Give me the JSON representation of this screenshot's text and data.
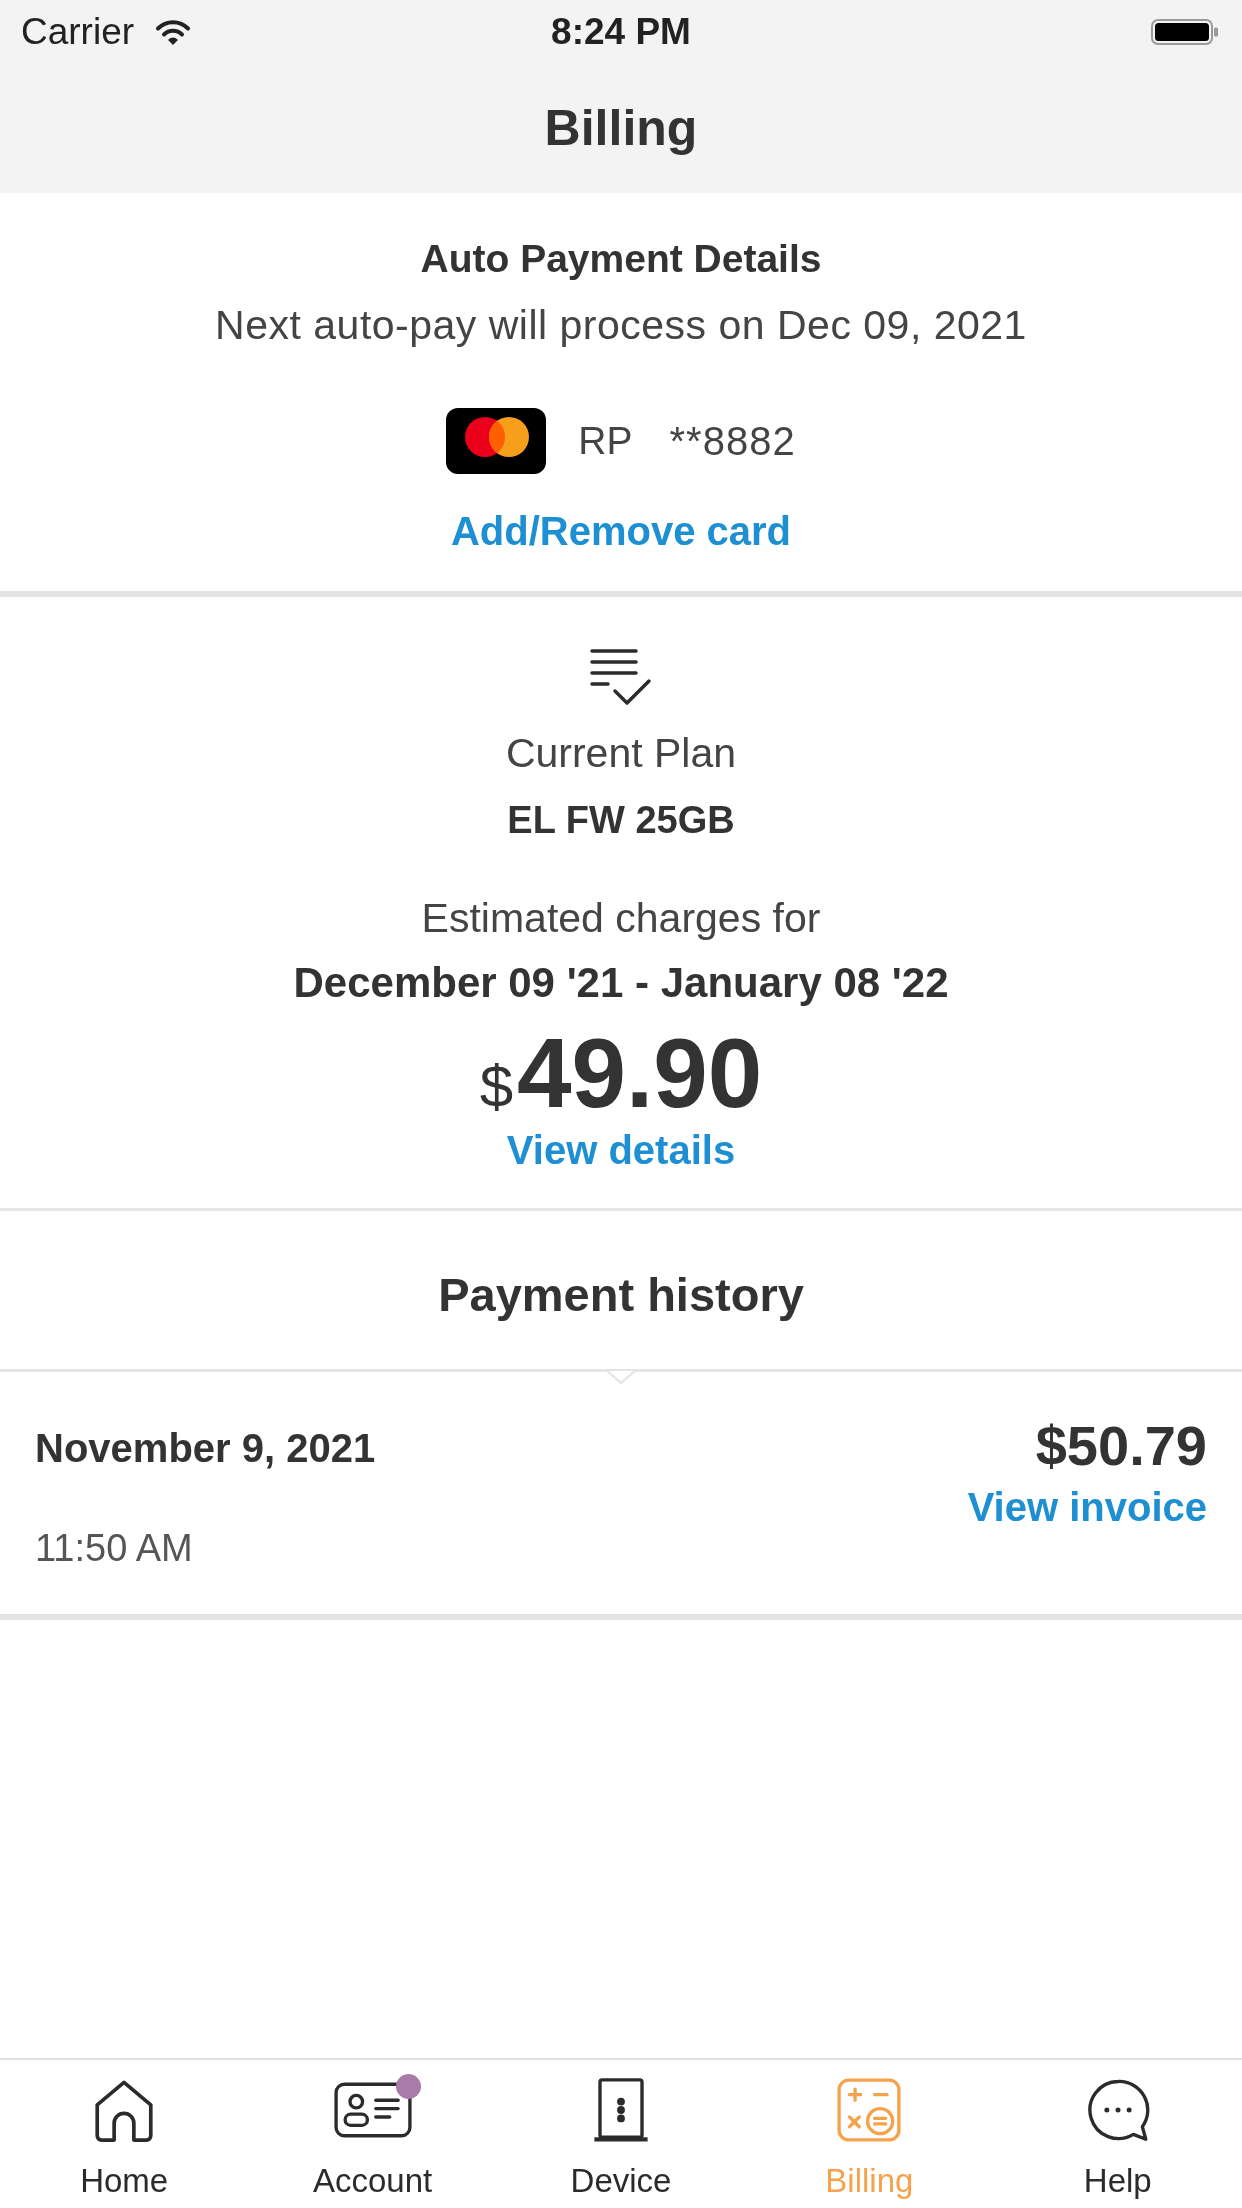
{
  "status_bar": {
    "carrier": "Carrier",
    "time": "8:24 PM"
  },
  "nav_bar": {
    "title": "Billing"
  },
  "auto_payment": {
    "title": "Auto Payment Details",
    "subtitle": "Next auto-pay will process on Dec 09, 2021",
    "card": {
      "holder": "RP",
      "number": "**8882"
    },
    "link": "Add/Remove card"
  },
  "plan": {
    "label": "Current Plan",
    "name": "EL FW 25GB",
    "charges_label": "Estimated charges for",
    "period": "December 09 '21 - January 08 '22",
    "currency": "$",
    "amount": "49.90",
    "link": "View details"
  },
  "payment_history": {
    "title": "Payment history",
    "items": [
      {
        "date": "November 9, 2021",
        "time": "11:50 AM",
        "amount": "$50.79",
        "link": "View invoice"
      }
    ]
  },
  "tab_bar": [
    {
      "label": "Home",
      "selected": false,
      "badge": false
    },
    {
      "label": "Account",
      "selected": false,
      "badge": true
    },
    {
      "label": "Device",
      "selected": false,
      "badge": false
    },
    {
      "label": "Billing",
      "selected": true,
      "badge": false
    },
    {
      "label": "Help",
      "selected": false,
      "badge": false
    }
  ]
}
